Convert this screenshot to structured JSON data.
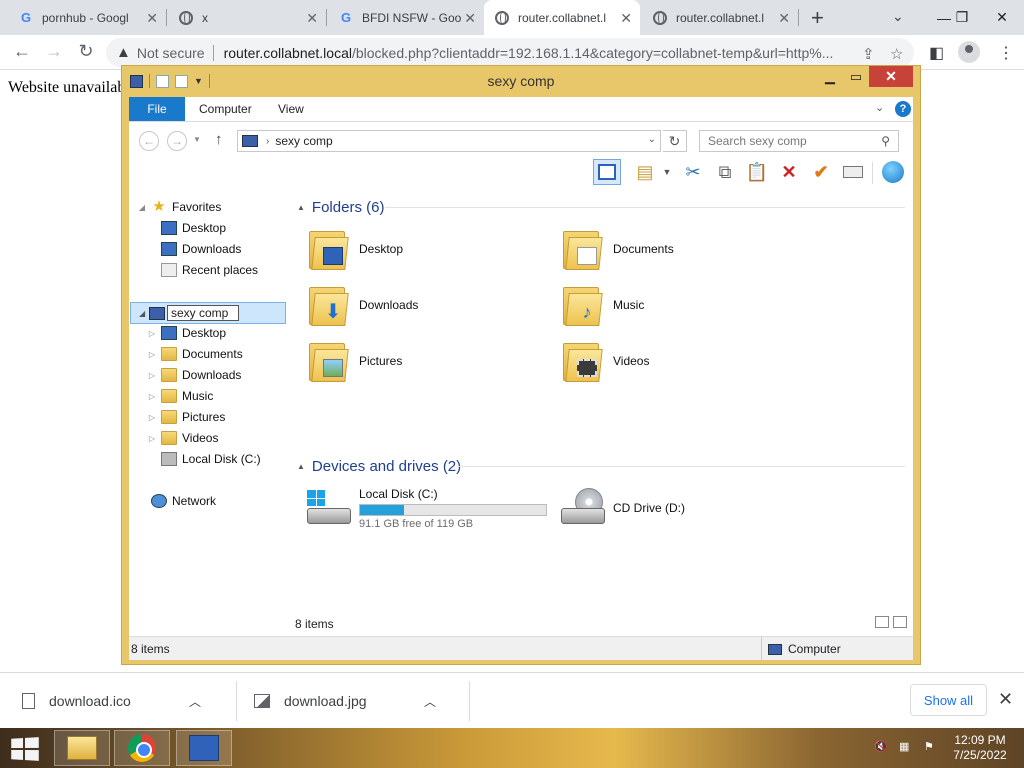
{
  "browser": {
    "tabs": [
      {
        "title": "pornhub - Googl",
        "favicon": "google-g-icon"
      },
      {
        "title": "x",
        "favicon": "globe-icon"
      },
      {
        "title": "BFDI NSFW - Goo",
        "favicon": "google-g-icon"
      },
      {
        "title": "router.collabnet.l",
        "favicon": "globe-icon",
        "active": true
      },
      {
        "title": "router.collabnet.l",
        "favicon": "globe-icon"
      }
    ],
    "security_label": "Not secure",
    "url_host": "router.collabnet.local",
    "url_rest": "/blocked.php?clientaddr=192.168.1.14&category=collabnet-temp&url=http%..."
  },
  "page": {
    "text": "Website unavailab"
  },
  "explorer": {
    "window_title": "sexy comp",
    "ribbon_tabs": [
      "File",
      "Computer",
      "View"
    ],
    "help_label": "?",
    "address": "sexy comp",
    "search_placeholder": "Search sexy comp",
    "nav": {
      "favorites_label": "Favorites",
      "favorites": [
        "Desktop",
        "Downloads",
        "Recent places"
      ],
      "computer_label": "sexy comp",
      "computer_items": [
        "Desktop",
        "Documents",
        "Downloads",
        "Music",
        "Pictures",
        "Videos",
        "Local Disk (C:)"
      ],
      "network_label": "Network"
    },
    "folders_header": "Folders (6)",
    "folders": [
      "Desktop",
      "Documents",
      "Downloads",
      "Music",
      "Pictures",
      "Videos"
    ],
    "devices_header": "Devices and drives (2)",
    "drives": [
      {
        "name": "Local Disk (C:)",
        "free_text": "91.1 GB free of 119 GB",
        "used_fraction": 0.234
      },
      {
        "name": "CD Drive (D:)"
      }
    ],
    "items_count": "8 items",
    "status_count": "8 items",
    "status_location": "Computer"
  },
  "downloads": {
    "items": [
      {
        "name": "download.ico",
        "icon": "file-icon"
      },
      {
        "name": "download.jpg",
        "icon": "image-icon"
      }
    ],
    "show_all_label": "Show all"
  },
  "taskbar": {
    "time": "12:09 PM",
    "date": "7/25/2022"
  },
  "colors": {
    "explorer_frame": "#e8c76a",
    "ribbon_file": "#1979ca",
    "drive_bar": "#26a0da",
    "close_button": "#c7433a"
  }
}
